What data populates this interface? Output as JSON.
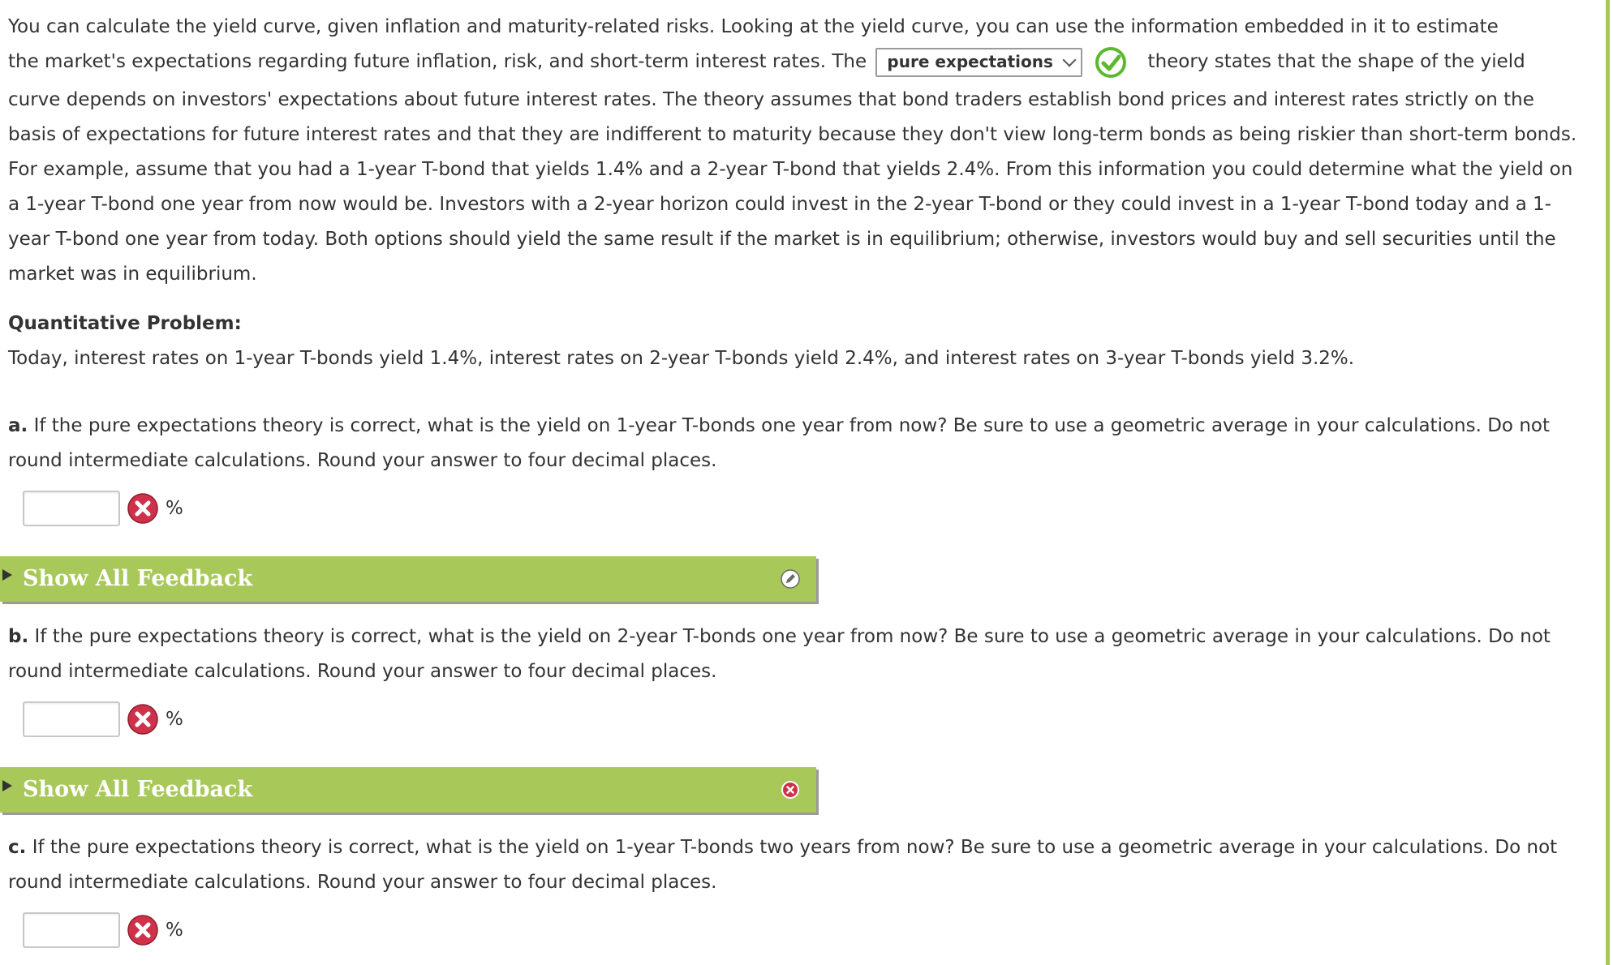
{
  "intro": {
    "line1": "You can calculate the yield curve, given inflation and maturity-related risks. Looking at the yield curve, you can use the information embedded in it to estimate",
    "line2_before": "the market's expectations regarding future inflation, risk, and short-term interest rates. The",
    "dropdown_value": "pure expectations",
    "line2_after": "theory states that the shape of the yield",
    "rest": "curve depends on investors' expectations about future interest rates. The theory assumes that bond traders establish bond prices and interest rates strictly on the basis of expectations for future interest rates and that they are indifferent to maturity because they don't view long-term bonds as being riskier than short-term bonds. For example, assume that you had a 1-year T-bond that yields 1.4% and a 2-year T-bond that yields 2.4%. From this information you could determine what the yield on a 1-year T-bond one year from now would be. Investors with a 2-year horizon could invest in the 2-year T-bond or they could invest in a 1-year T-bond today and a 1-year T-bond one year from today. Both options should yield the same result if the market is in equilibrium; otherwise, investors would buy and sell securities until the market was in equilibrium."
  },
  "problem": {
    "heading": "Quantitative Problem:",
    "text": "Today, interest rates on 1-year T-bonds yield 1.4%, interest rates on 2-year T-bonds yield 2.4%, and interest rates on 3-year T-bonds yield 3.2%."
  },
  "questions": [
    {
      "letter": "a.",
      "text": "If the pure expectations theory is correct, what is the yield on 1-year T-bonds one year from now? Be sure to use a geometric average in your calculations. Do not round intermediate calculations. Round your answer to four decimal places.",
      "value": "",
      "unit": "%",
      "status": "incorrect"
    },
    {
      "letter": "b.",
      "text": "If the pure expectations theory is correct, what is the yield on 2-year T-bonds one year from now? Be sure to use a geometric average in your calculations. Do not round intermediate calculations. Round your answer to four decimal places.",
      "value": "",
      "unit": "%",
      "status": "incorrect"
    },
    {
      "letter": "c.",
      "text": "If the pure expectations theory is correct, what is the yield on 1-year T-bonds two years from now? Be sure to use a geometric average in your calculations. Do not round intermediate calculations. Round your answer to four decimal places.",
      "value": "",
      "unit": "%",
      "status": "incorrect"
    }
  ],
  "feedback": [
    {
      "label": "Show All Feedback",
      "status_icon": "pencil-icon"
    },
    {
      "label": "Show All Feedback",
      "status_icon": "x-circle-icon"
    }
  ],
  "colors": {
    "accent_green": "#a8c85a",
    "correct_green": "#5cb82e",
    "incorrect_red": "#d0314a",
    "text": "#333333"
  }
}
